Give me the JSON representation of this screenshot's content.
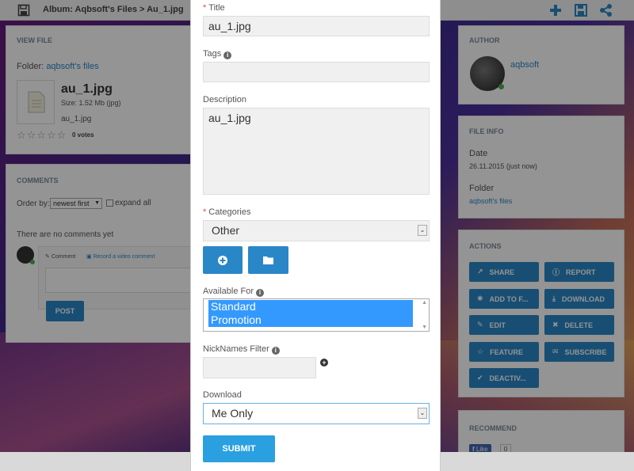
{
  "header": {
    "breadcrumb_album": "Album: Aqbsoft's Files",
    "breadcrumb_sep": ">",
    "breadcrumb_file": "Au_1.jpg"
  },
  "view_file": {
    "title": "VIEW FILE",
    "folder_label": "Folder:",
    "folder_link": "aqbsoft's files",
    "file_name": "au_1.jpg",
    "size_text": "Size: 1.52 Mb (jpg)",
    "caption": "au_1.jpg",
    "votes": "0 votes"
  },
  "comments": {
    "title": "COMMENTS",
    "order_label": "Order by:",
    "order_value": "newest first",
    "expand_label": "expand all",
    "empty_text": "There are no comments yet",
    "tab_comment": "Comment",
    "tab_video": "Record a video comment",
    "post_label": "POST"
  },
  "author": {
    "title": "AUTHOR",
    "name": "aqbsoft"
  },
  "file_info": {
    "title": "FILE INFO",
    "date_label": "Date",
    "date_value": "26.11.2015 (just now)",
    "folder_label": "Folder",
    "folder_value": "aqbsoft's files"
  },
  "actions": {
    "title": "ACTIONS",
    "buttons": [
      {
        "label": "SHARE",
        "icon": "share-icon"
      },
      {
        "label": "REPORT",
        "icon": "report-icon"
      },
      {
        "label": "ADD TO F...",
        "icon": "add-icon"
      },
      {
        "label": "DOWNLOAD",
        "icon": "download-icon"
      },
      {
        "label": "EDIT",
        "icon": "edit-icon"
      },
      {
        "label": "DELETE",
        "icon": "delete-icon"
      },
      {
        "label": "FEATURE",
        "icon": "star-icon"
      },
      {
        "label": "SUBSCRIBE",
        "icon": "subscribe-icon"
      },
      {
        "label": "DEACTIV...",
        "icon": "check-icon"
      }
    ]
  },
  "recommend": {
    "title": "RECOMMEND",
    "like_label": "Like",
    "like_count": "0"
  },
  "modal": {
    "title_label": "Title",
    "title_value": "au_1.jpg",
    "tags_label": "Tags",
    "tags_value": "",
    "description_label": "Description",
    "description_value": "au_1.jpg",
    "categories_label": "Categories",
    "categories_value": "Other",
    "available_label": "Available For",
    "available_options": [
      "Standard",
      "Promotion"
    ],
    "nicknames_label": "NickNames Filter",
    "download_label": "Download",
    "download_value": "Me Only",
    "submit_label": "SUBMIT"
  },
  "colors": {
    "accent": "#2a87c7",
    "submit": "#2aa0e0",
    "required": "#e24a4a",
    "selection": "#3399ff"
  }
}
